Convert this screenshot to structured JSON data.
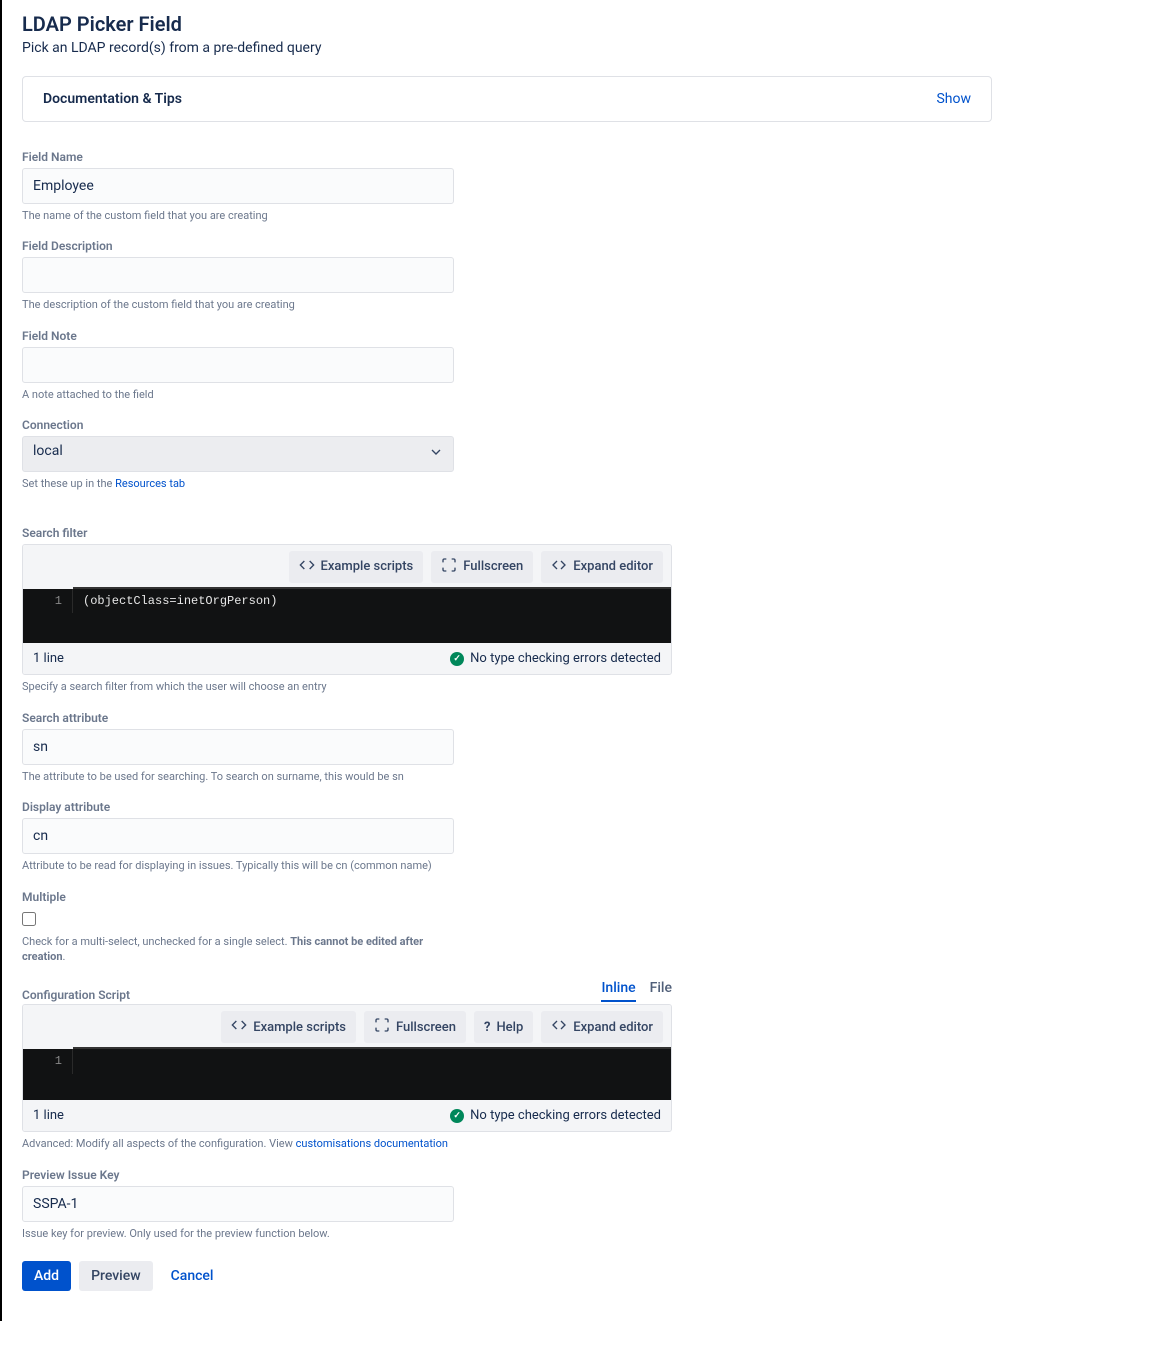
{
  "header": {
    "title": "LDAP Picker Field",
    "subtitle": "Pick an LDAP record(s) from a pre-defined query"
  },
  "docPanel": {
    "title": "Documentation & Tips",
    "toggle": "Show"
  },
  "fields": {
    "fieldName": {
      "label": "Field Name",
      "value": "Employee",
      "help": "The name of the custom field that you are creating"
    },
    "fieldDescription": {
      "label": "Field Description",
      "value": "",
      "help": "The description of the custom field that you are creating"
    },
    "fieldNote": {
      "label": "Field Note",
      "value": "",
      "help": "A note attached to the field"
    },
    "connection": {
      "label": "Connection",
      "value": "local",
      "helpPrefix": "Set these up in the ",
      "helpLink": "Resources tab"
    },
    "searchFilter": {
      "label": "Search filter",
      "lineNumber": "1",
      "code": "(objectClass=inetOrgPerson)",
      "status_lines": "1 line",
      "status_msg": "No type checking errors detected",
      "help": "Specify a search filter from which the user will choose an entry"
    },
    "searchAttribute": {
      "label": "Search attribute",
      "value": "sn",
      "help": "The attribute to be used for searching. To search on surname, this would be sn"
    },
    "displayAttribute": {
      "label": "Display attribute",
      "value": "cn",
      "help": "Attribute to be read for displaying in issues. Typically this will be cn (common name)"
    },
    "multiple": {
      "label": "Multiple",
      "helpPrefix": "Check for a multi-select, unchecked for a single select. ",
      "helpBold": "This cannot be edited after creation"
    },
    "configScript": {
      "label": "Configuration Script",
      "tabs": {
        "inline": "Inline",
        "file": "File"
      },
      "lineNumber": "1",
      "status_lines": "1 line",
      "status_msg": "No type checking errors detected",
      "helpPrefix": "Advanced: Modify all aspects of the configuration. View ",
      "helpLink": "customisations documentation"
    },
    "previewKey": {
      "label": "Preview Issue Key",
      "value": "SSPA-1",
      "help": "Issue key for preview. Only used for the preview function below."
    }
  },
  "toolbar": {
    "exampleScripts": "Example scripts",
    "fullscreen": "Fullscreen",
    "expand": "Expand editor",
    "help": "Help"
  },
  "actions": {
    "add": "Add",
    "preview": "Preview",
    "cancel": "Cancel"
  }
}
